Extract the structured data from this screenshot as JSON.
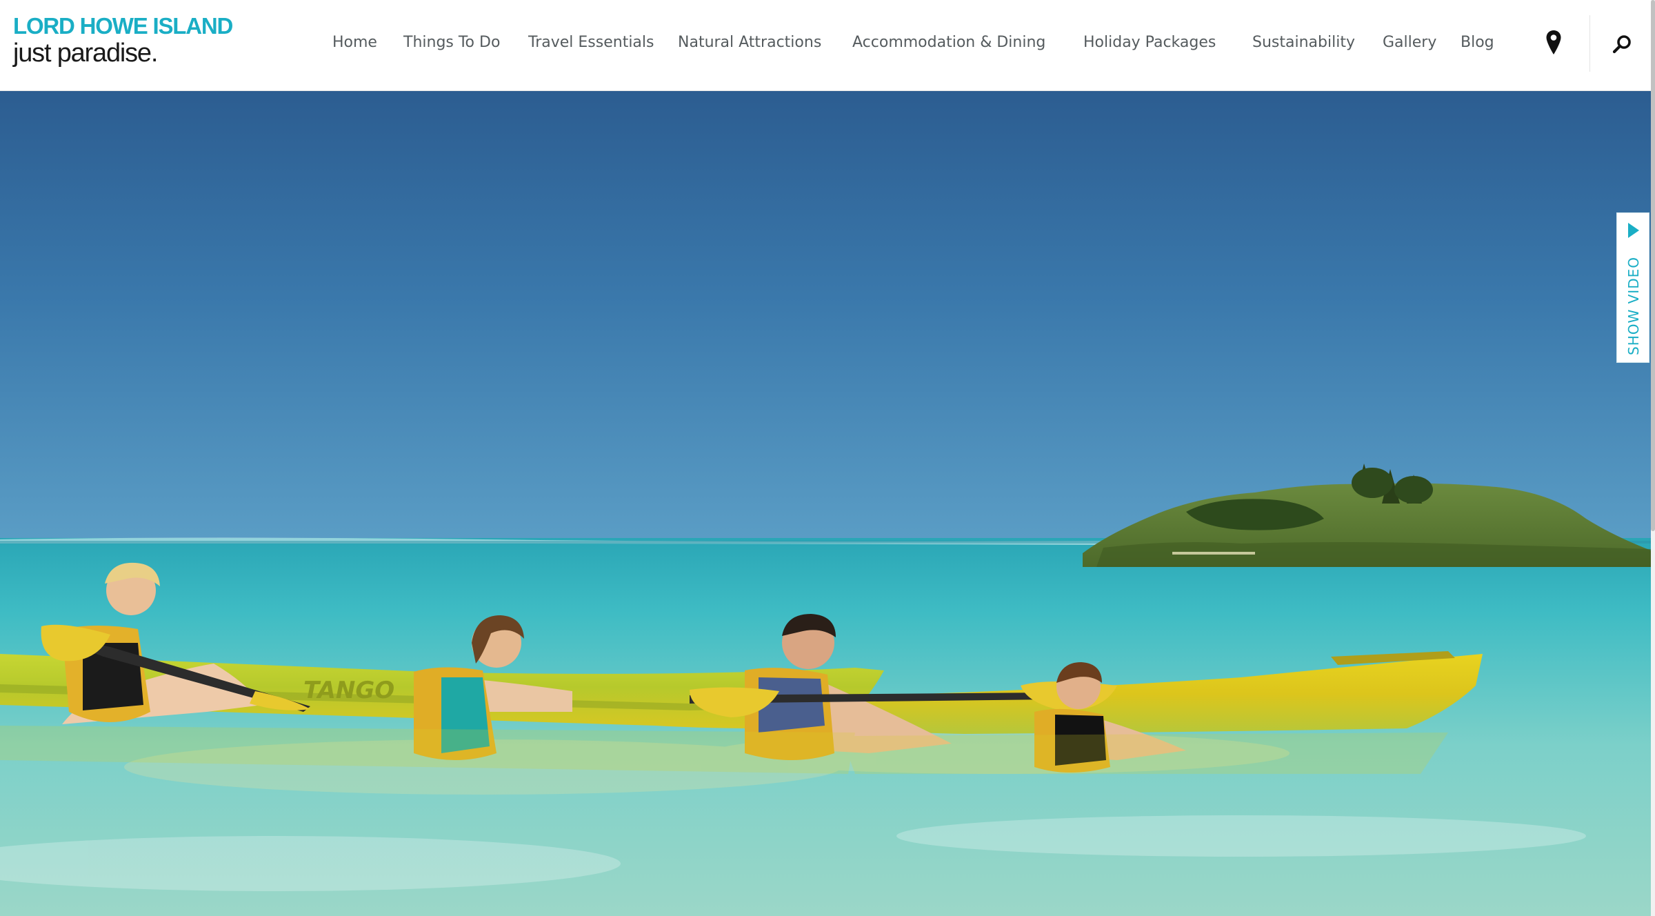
{
  "site": {
    "logo_line1": "LORD HOWE ISLAND",
    "logo_line2": "just paradise."
  },
  "nav": {
    "items": [
      {
        "label": "Home"
      },
      {
        "label": "Things To Do"
      },
      {
        "label": "Travel Essentials"
      },
      {
        "label": "Natural Attractions"
      },
      {
        "label": "Accommodation & Dining"
      },
      {
        "label": "Holiday Packages"
      },
      {
        "label": "Sustainability"
      },
      {
        "label": "Gallery"
      },
      {
        "label": "Blog"
      }
    ],
    "icons": [
      "map-pin-icon",
      "search-icon"
    ]
  },
  "hero": {
    "kayak_brand": "TANGO",
    "show_video_label": "SHOW VIDEO"
  },
  "colors": {
    "brand_teal": "#1aaec5",
    "nav_text": "#555b5e",
    "kayak_yellow": "#e4d21c"
  }
}
